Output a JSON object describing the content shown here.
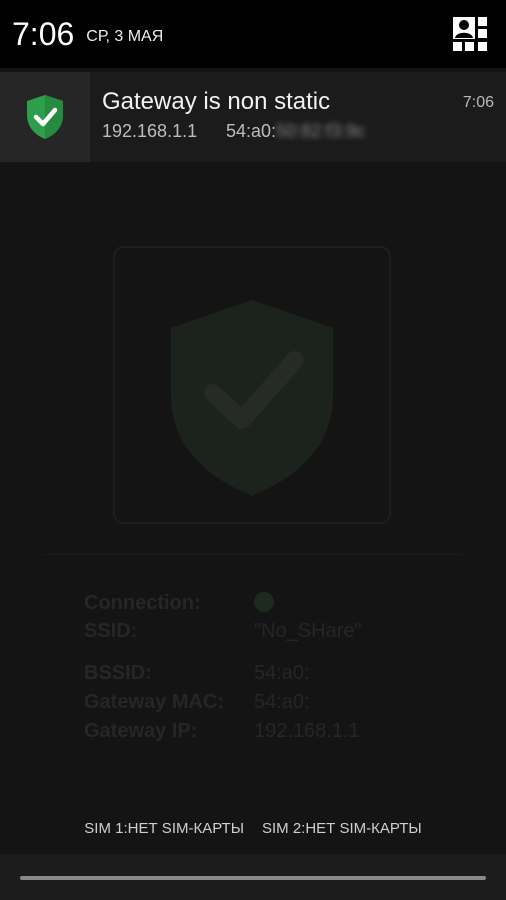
{
  "status_bar": {
    "time": "7:06",
    "date": "СР, 3 МАЯ",
    "settings_icon": "quick-settings-icon"
  },
  "notification": {
    "icon": "shield-check-icon",
    "title": "Gateway is non static",
    "time": "7:06",
    "ip": "192.168.1.1",
    "mac_prefix": "54:a0:",
    "mac_hidden": "50:82:f3:9c",
    "accent_color": "#2e9e4a"
  },
  "background_app": {
    "connection_label": "Connection:",
    "ssid_label": "SSID:",
    "ssid_value": "\"No_SHare\"",
    "bssid_label": "BSSID:",
    "bssid_value": "54:a0:",
    "gateway_mac_label": "Gateway MAC:",
    "gateway_mac_value": "54:a0:",
    "gateway_ip_label": "Gateway IP:",
    "gateway_ip_value": "192.168.1.1"
  },
  "carrier": {
    "sim1": "SIM 1:НЕТ SIM-КАРТЫ",
    "sim2": "SIM 2:НЕТ SIM-КАРТЫ"
  }
}
